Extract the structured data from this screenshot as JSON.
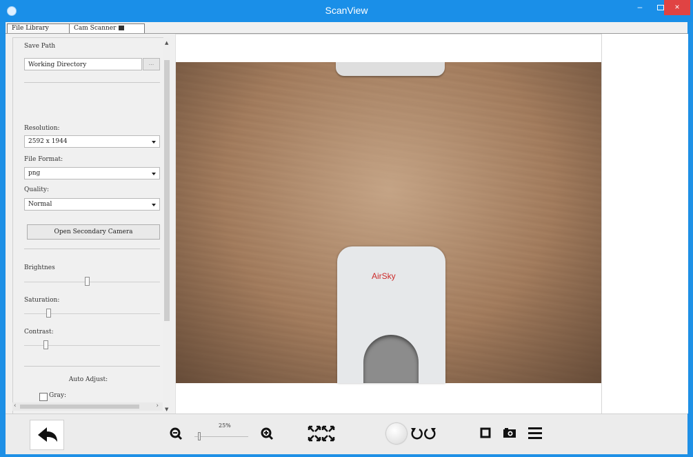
{
  "window": {
    "title": "ScanView",
    "min_label": "–",
    "close_label": "×"
  },
  "tabs": [
    {
      "label": "File Library"
    },
    {
      "label": "Cam Scanner"
    }
  ],
  "settings": {
    "save_path_label": "Save Path",
    "save_path_value": "Working Directory",
    "browse_label": "...",
    "resolution_label": "Resolution:",
    "resolution_value": "2592 x 1944",
    "file_format_label": "File Format:",
    "file_format_value": "png",
    "quality_label": "Quality:",
    "quality_value": "Normal",
    "secondary_camera_button": "Open Secondary Camera",
    "brightness_label": "Brightnes",
    "saturation_label": "Saturation:",
    "contrast_label": "Contrast:",
    "auto_adjust_label": "Auto Adjust:",
    "gray_label": "Gray:"
  },
  "preview": {
    "device_logo": "AirSky"
  },
  "toolbar": {
    "zoom_value": "25%"
  },
  "icons": [
    "back-arrow-icon",
    "zoom-out-icon",
    "zoom-in-icon",
    "fit-screen-icon",
    "capture-icon",
    "rotate-left-icon",
    "rotate-right-icon",
    "crop-icon",
    "camera-icon",
    "menu-icon"
  ],
  "colors": {
    "titlebar": "#1a8fe8",
    "close": "#e04343",
    "logo": "#cc2a2a"
  }
}
